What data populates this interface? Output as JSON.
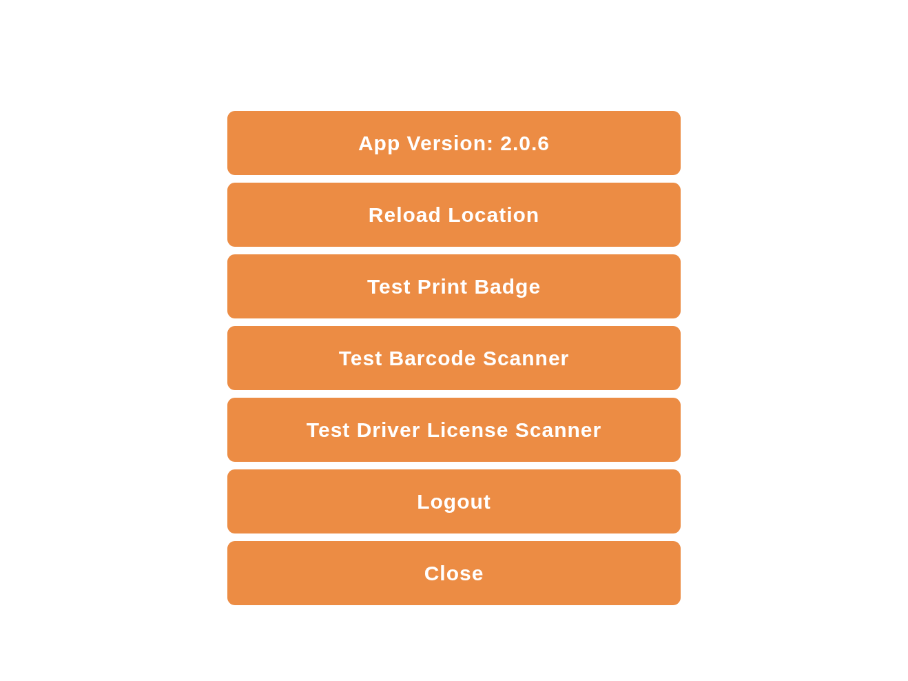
{
  "menu": {
    "buttons": [
      {
        "label": "App Version: 2.0.6"
      },
      {
        "label": "Reload Location"
      },
      {
        "label": "Test Print Badge"
      },
      {
        "label": "Test Barcode Scanner"
      },
      {
        "label": "Test Driver License Scanner"
      },
      {
        "label": "Logout"
      },
      {
        "label": "Close"
      }
    ]
  }
}
